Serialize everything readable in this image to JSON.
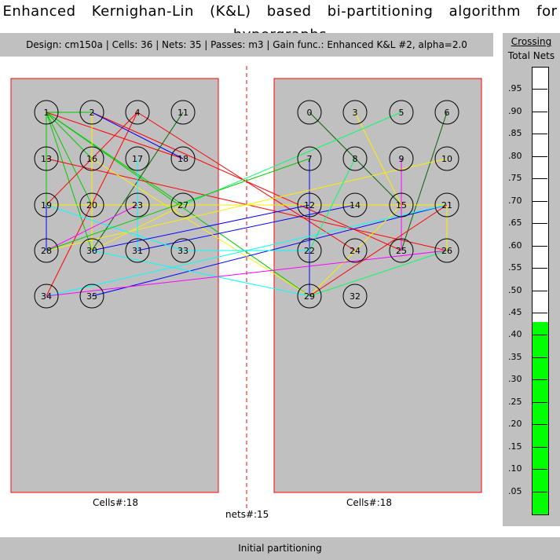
{
  "window": {
    "title": "Enhanced Kernighan-Lin (K&L) based bi-partitioning algorithm for hypergraphs"
  },
  "info": {
    "text": "Design: cm150a | Cells: 36 | Nets: 35 | Passes: m3 | Gain func.: Enhanced K&L #2, alpha=2.0"
  },
  "crossing_panel": {
    "title": "Crossing",
    "subtitle": "Total Nets",
    "ticks": [
      ".95",
      ".90",
      ".85",
      ".80",
      ".75",
      ".70",
      ".65",
      ".60",
      ".55",
      ".50",
      ".45",
      ".40",
      ".35",
      ".30",
      ".25",
      ".20",
      ".15",
      ".10",
      ".05"
    ],
    "ratio": 0.43,
    "fill_color": "#00ff00"
  },
  "partitions": {
    "left": {
      "cells_label": "Cells#:18",
      "nodes": [
        {
          "id": "1"
        },
        {
          "id": "2"
        },
        {
          "id": "4"
        },
        {
          "id": "11"
        },
        {
          "id": "13"
        },
        {
          "id": "16"
        },
        {
          "id": "17"
        },
        {
          "id": "18"
        },
        {
          "id": "19"
        },
        {
          "id": "20"
        },
        {
          "id": "23"
        },
        {
          "id": "27"
        },
        {
          "id": "28"
        },
        {
          "id": "30"
        },
        {
          "id": "31"
        },
        {
          "id": "33"
        },
        {
          "id": "34"
        },
        {
          "id": "35"
        }
      ]
    },
    "right": {
      "cells_label": "Cells#:18",
      "nodes": [
        {
          "id": "0"
        },
        {
          "id": "3"
        },
        {
          "id": "5"
        },
        {
          "id": "6"
        },
        {
          "id": "7"
        },
        {
          "id": "8"
        },
        {
          "id": "9"
        },
        {
          "id": "10"
        },
        {
          "id": "12"
        },
        {
          "id": "14"
        },
        {
          "id": "15"
        },
        {
          "id": "21"
        },
        {
          "id": "22"
        },
        {
          "id": "24"
        },
        {
          "id": "25"
        },
        {
          "id": "26"
        },
        {
          "id": "29"
        },
        {
          "id": "32"
        }
      ]
    },
    "nets_label": "nets#:15",
    "colors": {
      "border": "#ff0000",
      "fill": "#c0c0c0",
      "divider": "#ff0000"
    }
  },
  "nets": [
    {
      "c": "#00cc00",
      "p": [
        "1",
        "2"
      ]
    },
    {
      "c": "#00cc00",
      "p": [
        "1",
        "16"
      ]
    },
    {
      "c": "#00cc00",
      "p": [
        "1",
        "19"
      ]
    },
    {
      "c": "#00cc00",
      "p": [
        "1",
        "20"
      ]
    },
    {
      "c": "#00cc00",
      "p": [
        "1",
        "27"
      ]
    },
    {
      "c": "#00cc00",
      "p": [
        "1",
        "29"
      ]
    },
    {
      "c": "#00cc00",
      "p": [
        "1",
        "30"
      ]
    },
    {
      "c": "#ff0000",
      "p": [
        "1",
        "18"
      ]
    },
    {
      "c": "#ff0000",
      "p": [
        "13",
        "26"
      ]
    },
    {
      "c": "#ff0000",
      "p": [
        "2",
        "25"
      ]
    },
    {
      "c": "#ff0000",
      "p": [
        "4",
        "34"
      ]
    },
    {
      "c": "#ff0000",
      "p": [
        "4",
        "19"
      ]
    },
    {
      "c": "#ff0000",
      "p": [
        "4",
        "24"
      ]
    },
    {
      "c": "#0000ff",
      "p": [
        "2",
        "18"
      ]
    },
    {
      "c": "#0000ff",
      "p": [
        "19",
        "28"
      ]
    },
    {
      "c": "#0000ff",
      "p": [
        "35",
        "21"
      ]
    },
    {
      "c": "#0000ff",
      "p": [
        "7",
        "29"
      ]
    },
    {
      "c": "#0000ff",
      "p": [
        "31",
        "14"
      ]
    },
    {
      "c": "#006600",
      "p": [
        "11",
        "30"
      ]
    },
    {
      "c": "#006600",
      "p": [
        "0",
        "15"
      ]
    },
    {
      "c": "#006600",
      "p": [
        "6",
        "25"
      ]
    },
    {
      "c": "#006600",
      "p": [
        "21",
        "26"
      ]
    },
    {
      "c": "#ffee00",
      "p": [
        "2",
        "30"
      ]
    },
    {
      "c": "#ffee00",
      "p": [
        "16",
        "29"
      ]
    },
    {
      "c": "#ffee00",
      "p": [
        "19",
        "21"
      ]
    },
    {
      "c": "#ffee00",
      "p": [
        "28",
        "10"
      ]
    },
    {
      "c": "#ffee00",
      "p": [
        "3",
        "15"
      ]
    },
    {
      "c": "#ffee00",
      "p": [
        "15",
        "29"
      ]
    },
    {
      "c": "#ffee00",
      "p": [
        "21",
        "26"
      ]
    },
    {
      "c": "#ffee00",
      "p": [
        "30",
        "27"
      ]
    },
    {
      "c": "#00ffff",
      "p": [
        "19",
        "33"
      ]
    },
    {
      "c": "#00ffff",
      "p": [
        "30",
        "29"
      ]
    },
    {
      "c": "#00ffff",
      "p": [
        "34",
        "21"
      ]
    },
    {
      "c": "#00ffff",
      "p": [
        "17",
        "31"
      ]
    },
    {
      "c": "#00ffff",
      "p": [
        "33",
        "22"
      ]
    },
    {
      "c": "#ff00ff",
      "p": [
        "34",
        "26"
      ]
    },
    {
      "c": "#ff00ff",
      "p": [
        "28",
        "23"
      ]
    },
    {
      "c": "#ff00ff",
      "p": [
        "9",
        "25"
      ]
    },
    {
      "c": "#00ff66",
      "p": [
        "5",
        "27"
      ]
    },
    {
      "c": "#00ff66",
      "p": [
        "29",
        "26"
      ]
    },
    {
      "c": "#00ff66",
      "p": [
        "22",
        "8"
      ]
    },
    {
      "c": "#ff0000",
      "p": [
        "29",
        "21"
      ]
    },
    {
      "c": "#0000ff",
      "p": [
        "30",
        "12"
      ]
    },
    {
      "c": "#00cc00",
      "p": [
        "28",
        "7"
      ]
    }
  ],
  "status": {
    "text": "Initial partitioning"
  }
}
